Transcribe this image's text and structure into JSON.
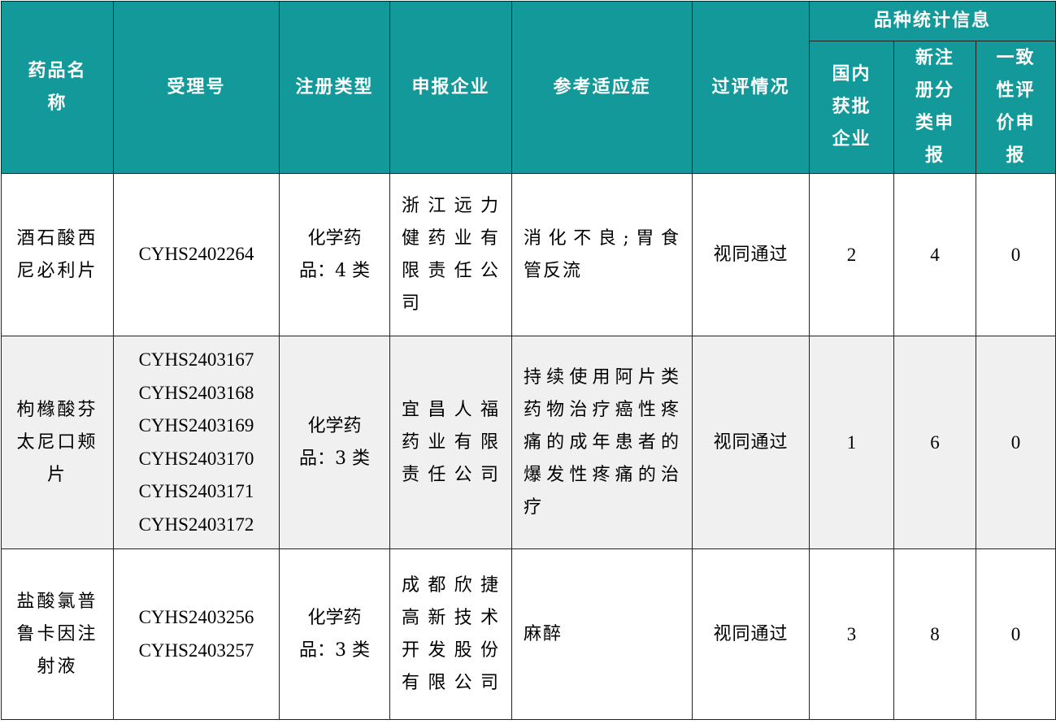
{
  "headers": {
    "drug_name": [
      "药品名",
      "称"
    ],
    "acceptance_no": "受理号",
    "registration_type": "注册类型",
    "applicant": "申报企业",
    "indication": "参考适应症",
    "review_status": "过评情况",
    "stats_group": "品种统计信息",
    "domestic_approved": [
      "国内",
      "获批",
      "企业"
    ],
    "new_reg_applications": [
      "新注",
      "册分",
      "类申",
      "报"
    ],
    "consistency_applications": [
      "一致",
      "性评",
      "价申",
      "报"
    ]
  },
  "rows": [
    {
      "drug_name": [
        "酒石酸西",
        "尼必利片"
      ],
      "acceptance_no": [
        "CYHS2402264"
      ],
      "registration_type": [
        "化学药",
        "品：4 类"
      ],
      "applicant": [
        "浙江远力",
        "健药业有",
        "限责任公",
        "司"
      ],
      "indication": [
        "消化不良;胃食",
        "管反流"
      ],
      "review_status": "视同通过",
      "domestic_approved": "2",
      "new_reg_applications": "4",
      "consistency_applications": "0"
    },
    {
      "drug_name": [
        "枸橼酸芬",
        "太尼口颊",
        "片"
      ],
      "acceptance_no": [
        "CYHS2403167",
        "CYHS2403168",
        "CYHS2403169",
        "CYHS2403170",
        "CYHS2403171",
        "CYHS2403172"
      ],
      "registration_type": [
        "化学药",
        "品：3 类"
      ],
      "applicant": [
        "宜昌人福",
        "药业有限",
        "责任公司"
      ],
      "indication": [
        "持续使用阿片类",
        "药物治疗癌性疼",
        "痛的成年患者的",
        "爆发性疼痛的治",
        "疗"
      ],
      "review_status": "视同通过",
      "domestic_approved": "1",
      "new_reg_applications": "6",
      "consistency_applications": "0"
    },
    {
      "drug_name": [
        "盐酸氯普",
        "鲁卡因注",
        "射液"
      ],
      "acceptance_no": [
        "CYHS2403256",
        "CYHS2403257"
      ],
      "registration_type": [
        "化学药",
        "品：3 类"
      ],
      "applicant": [
        "成都欣捷",
        "高新技术",
        "开发股份",
        "有限公司"
      ],
      "indication": [
        "麻醉"
      ],
      "review_status": "视同通过",
      "domestic_approved": "3",
      "new_reg_applications": "8",
      "consistency_applications": "0"
    }
  ],
  "colors": {
    "header_bg": "#13999a",
    "header_text": "#ffffff",
    "alt_row_bg": "#f0f0f0"
  }
}
